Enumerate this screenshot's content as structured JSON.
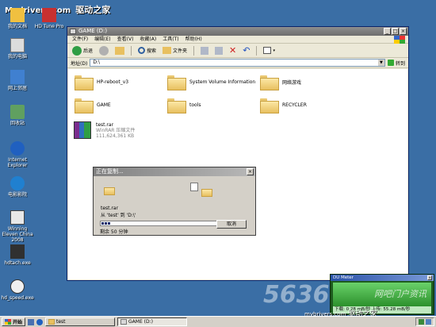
{
  "watermark_top": {
    "brand": "Mydrivers.com",
    "cn": "驱动之家"
  },
  "desktop_icons": [
    {
      "label": "我的文档",
      "color": "#f0c040"
    },
    {
      "label": "HD Tune Pro",
      "color": "#c83030"
    },
    {
      "label": "我的电脑",
      "color": "#e0e0e0"
    },
    {
      "label": "网上邻居",
      "color": "#4080d0"
    },
    {
      "label": "回收站",
      "color": "#60a060"
    },
    {
      "label": "Internet Explorer",
      "color": "#2060c0"
    },
    {
      "label": "电影影院",
      "color": "#2080d0"
    },
    {
      "label": "Winning Eleven China 2008",
      "color": "#e8e8e8"
    },
    {
      "label": "hdtach.exe",
      "color": "#303030"
    },
    {
      "label": "hd_speed.exe",
      "color": "#f0f0f0"
    }
  ],
  "explorer": {
    "title": "GAME (D:)",
    "menu": [
      "文件(F)",
      "编辑(E)",
      "查看(V)",
      "收藏(A)",
      "工具(T)",
      "帮助(H)"
    ],
    "toolbar": {
      "back": "后退",
      "search": "搜索",
      "folders": "文件夹"
    },
    "address_label": "地址(D)",
    "address_value": "D:\\",
    "go_label": "转到",
    "items": [
      {
        "type": "folder",
        "name": "HP-reboot_v3"
      },
      {
        "type": "folder",
        "name": "System Volume Information"
      },
      {
        "type": "folder",
        "name": "网络游戏"
      },
      {
        "type": "folder",
        "name": "GAME"
      },
      {
        "type": "folder",
        "name": "tools"
      },
      {
        "type": "folder",
        "name": "RECYCLER"
      }
    ],
    "rar": {
      "name": "test.rar",
      "kind": "WinRAR 压缩文件",
      "size": "111,624,361 KB"
    }
  },
  "copy_dialog": {
    "title": "正在复制...",
    "filename": "test.rar",
    "from_to": "从 'test' 到 'D:\\'",
    "progress_fraction": 0.08,
    "remaining": "剩余 50 分钟",
    "cancel": "取消"
  },
  "du_meter": {
    "title": "DU Meter",
    "overlay": "网吧门户资讯",
    "stats": "下载: 0.28 mB/秒  上传: 55.28 mB/秒"
  },
  "num_watermark": "5636",
  "site_watermark": {
    "url": "mybrivers.com",
    "cn": "驱动之家"
  },
  "taskbar": {
    "start": "开始",
    "tasks": [
      {
        "label": "test"
      },
      {
        "label": "GAME (D:)"
      }
    ]
  }
}
